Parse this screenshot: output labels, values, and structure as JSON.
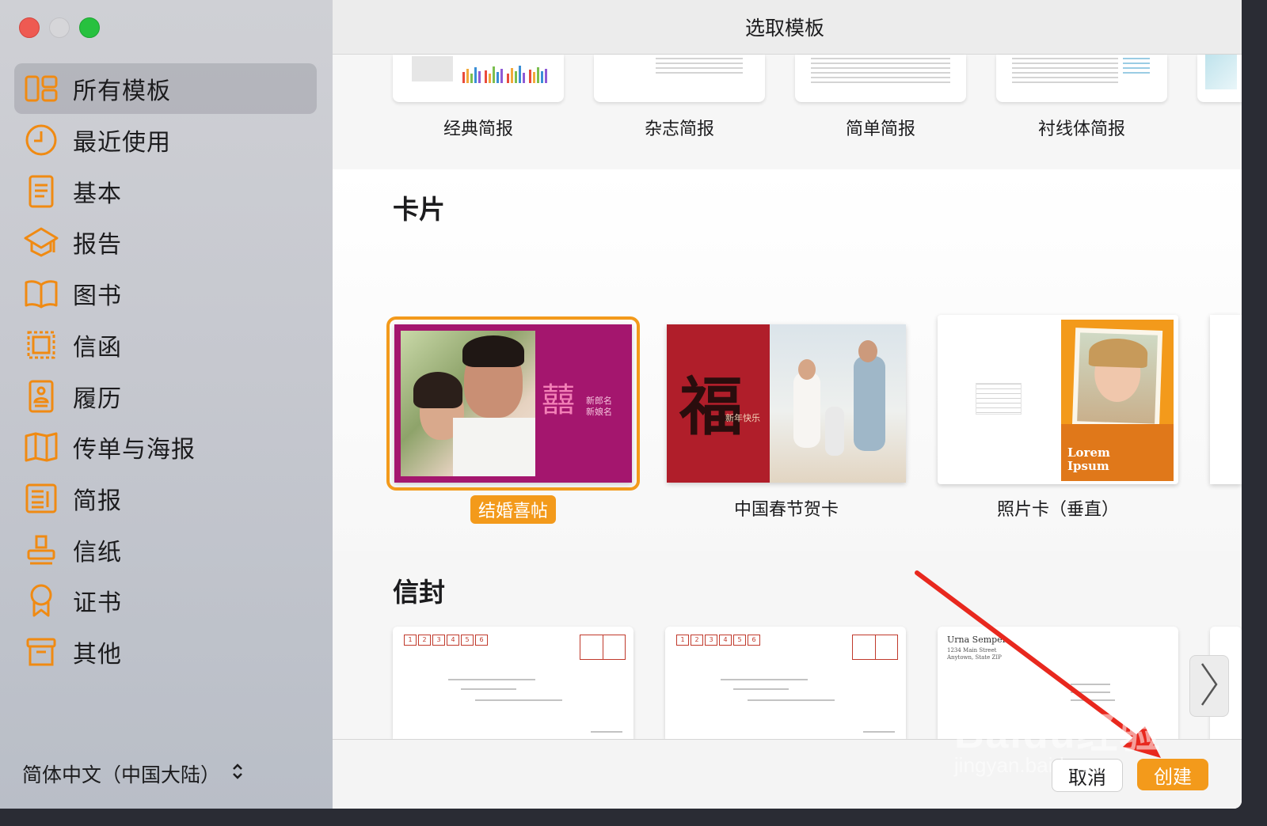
{
  "window": {
    "title": "选取模板"
  },
  "sidebar": {
    "items": [
      {
        "label": "所有模板",
        "icon": "grid-icon",
        "active": true
      },
      {
        "label": "最近使用",
        "icon": "clock-icon"
      },
      {
        "label": "基本",
        "icon": "document-icon"
      },
      {
        "label": "报告",
        "icon": "graduation-cap-icon"
      },
      {
        "label": "图书",
        "icon": "book-icon"
      },
      {
        "label": "信函",
        "icon": "stamp-frame-icon"
      },
      {
        "label": "履历",
        "icon": "resume-icon"
      },
      {
        "label": "传单与海报",
        "icon": "flyer-icon"
      },
      {
        "label": "简报",
        "icon": "newsletter-icon"
      },
      {
        "label": "信纸",
        "icon": "stamp-icon"
      },
      {
        "label": "证书",
        "icon": "ribbon-icon"
      },
      {
        "label": "其他",
        "icon": "archive-box-icon"
      }
    ],
    "language": "简体中文（中国大陆）"
  },
  "newsletters": {
    "items": [
      {
        "label": "经典简报"
      },
      {
        "label": "杂志简报"
      },
      {
        "label": "简单简报"
      },
      {
        "label": "衬线体简报"
      }
    ]
  },
  "cards": {
    "title": "卡片",
    "items": [
      {
        "label": "结婚喜帖",
        "selected": true,
        "names": [
          "新郎名",
          "新娘名"
        ],
        "glyph": "囍"
      },
      {
        "label": "中国春节贺卡",
        "glyph": "福",
        "greeting": "新年快乐"
      },
      {
        "label": "照片卡（垂直）",
        "caption": "Lorem Ipsum"
      }
    ]
  },
  "envelopes": {
    "title": "信封",
    "zip": [
      "1",
      "2",
      "3",
      "4",
      "5",
      "6"
    ],
    "sender": {
      "name": "Urna Semper",
      "line1": "1234 Main Street",
      "line2": "Anytown, State ZIP"
    }
  },
  "footer": {
    "cancel": "取消",
    "create": "创建"
  },
  "watermark": {
    "brand": "Baidu经验",
    "url": "jingyan.baidu.com"
  },
  "colors": {
    "accent": "#f39a1b",
    "sidebar_icon": "#f08a12",
    "arrow": "#e8281e"
  }
}
